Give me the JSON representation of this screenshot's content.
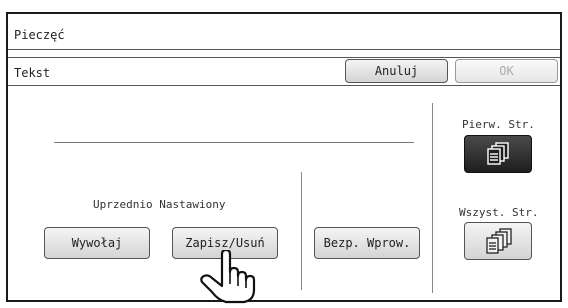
{
  "window": {
    "title": "Pieczęć"
  },
  "section": {
    "title": "Tekst"
  },
  "toolbar": {
    "cancel_label": "Anuluj",
    "ok_label": "OK"
  },
  "preset": {
    "label": "Uprzednio Nastawiony",
    "recall_label": "Wywołaj",
    "save_delete_label": "Zapisz/Usuń"
  },
  "direct": {
    "label": "Bezp. Wprow."
  },
  "pages": {
    "first_label": "Pierw. Str.",
    "all_label": "Wszyst. Str.",
    "selected": "first"
  },
  "icons": {
    "first_page": "document-stack-icon",
    "all_pages": "document-stack-icon",
    "pointer": "hand-pointer-icon"
  }
}
